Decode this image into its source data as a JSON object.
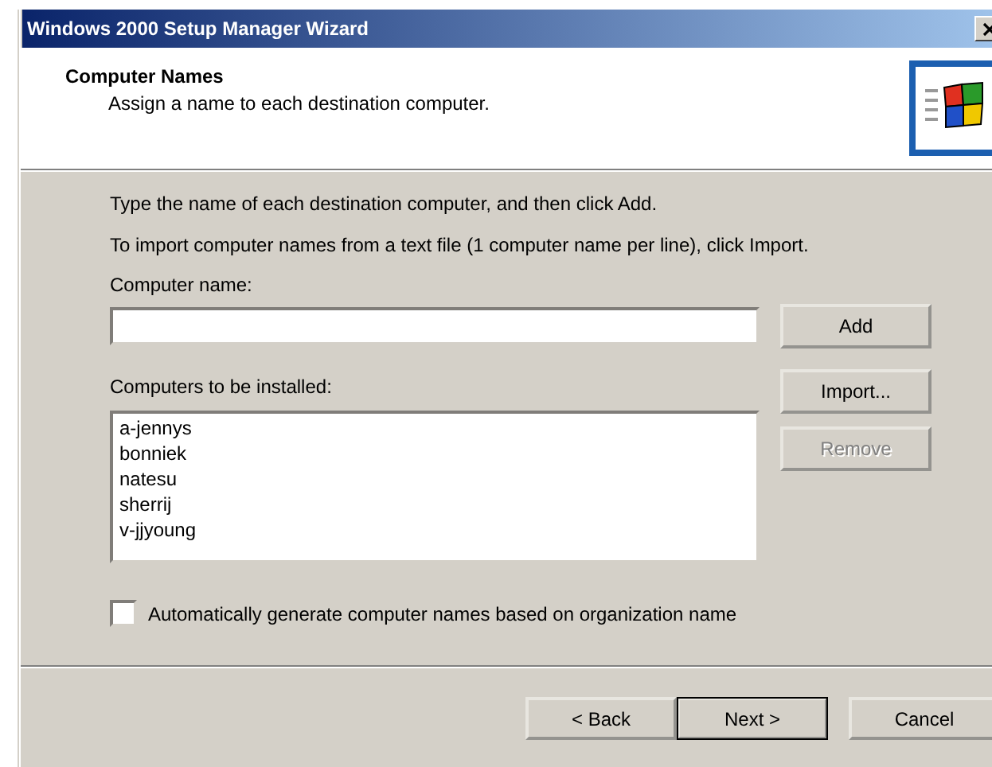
{
  "window": {
    "title": "Windows 2000 Setup Manager Wizard"
  },
  "header": {
    "title": "Computer Names",
    "subtitle": "Assign a name to each destination computer."
  },
  "instructions": [
    "Type the name of each destination computer, and then click Add.",
    "To import computer names from a text file (1 computer name per line), click Import."
  ],
  "computer_name": {
    "label": "Computer name:"
  },
  "add_button": {
    "label": "Add",
    "disabled": false
  },
  "list": {
    "label": "Computers to be installed:",
    "items": [
      "a-jennys",
      "bonniek",
      "natesu",
      "sherrij",
      "v-jjyoung"
    ]
  },
  "side_buttons": [
    {
      "label": "Import...",
      "disabled": false
    },
    {
      "label": "Remove",
      "disabled": true
    }
  ],
  "auto_generate": {
    "label": "Automatically generate computer names based on organization name",
    "checked": false
  },
  "buttons": [
    {
      "label": "< Back",
      "default": false
    },
    {
      "label": "Next >",
      "default": true
    },
    {
      "label": "Cancel",
      "default": false
    }
  ]
}
